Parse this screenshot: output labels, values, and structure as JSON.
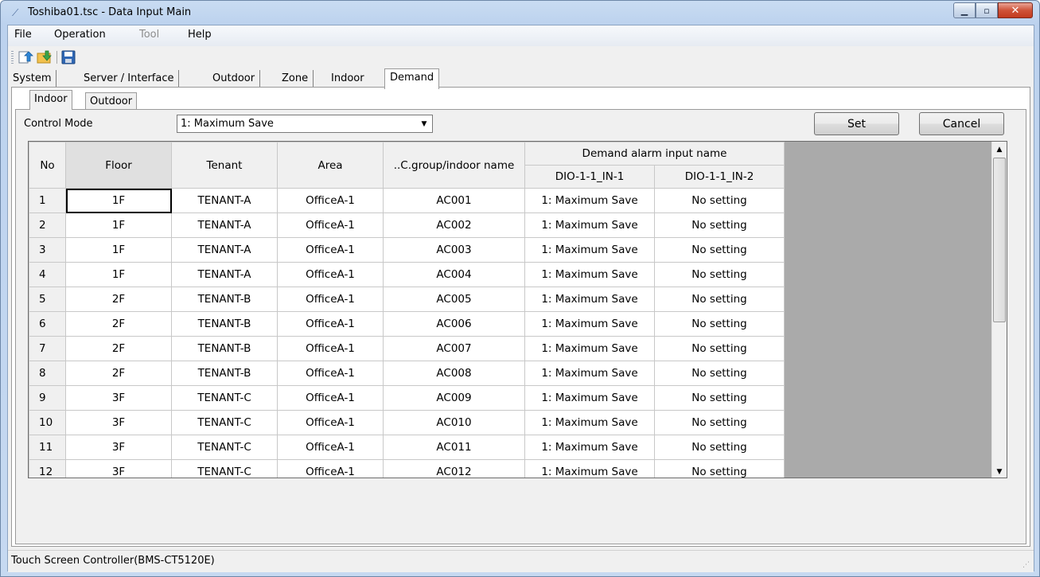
{
  "window": {
    "title": "Toshiba01.tsc - Data Input Main"
  },
  "menu": {
    "file": "File",
    "operation": "Operation",
    "tool": "Tool",
    "help": "Help"
  },
  "tabs": [
    "System",
    "Server / Interface",
    "Outdoor",
    "Zone",
    "Indoor",
    "Demand"
  ],
  "active_tab": "Demand",
  "subtabs": [
    "Indoor",
    "Outdoor"
  ],
  "active_subtab": "Indoor",
  "control_mode": {
    "label": "Control Mode",
    "value": "1: Maximum Save"
  },
  "buttons": {
    "set": "Set",
    "cancel": "Cancel"
  },
  "grid": {
    "headers": {
      "no": "No",
      "floor": "Floor",
      "tenant": "Tenant",
      "area": "Area",
      "group": "..C.group/indoor name",
      "demand_group": "Demand alarm input name",
      "in1": "DIO-1-1_IN-1",
      "in2": "DIO-1-1_IN-2"
    },
    "rows": [
      {
        "no": "1",
        "floor": "1F",
        "tenant": "TENANT-A",
        "area": "OfficeA-1",
        "group": "AC001",
        "in1": "1: Maximum Save",
        "in2": "No setting"
      },
      {
        "no": "2",
        "floor": "1F",
        "tenant": "TENANT-A",
        "area": "OfficeA-1",
        "group": "AC002",
        "in1": "1: Maximum Save",
        "in2": "No setting"
      },
      {
        "no": "3",
        "floor": "1F",
        "tenant": "TENANT-A",
        "area": "OfficeA-1",
        "group": "AC003",
        "in1": "1: Maximum Save",
        "in2": "No setting"
      },
      {
        "no": "4",
        "floor": "1F",
        "tenant": "TENANT-A",
        "area": "OfficeA-1",
        "group": "AC004",
        "in1": "1: Maximum Save",
        "in2": "No setting"
      },
      {
        "no": "5",
        "floor": "2F",
        "tenant": "TENANT-B",
        "area": "OfficeA-1",
        "group": "AC005",
        "in1": "1: Maximum Save",
        "in2": "No setting"
      },
      {
        "no": "6",
        "floor": "2F",
        "tenant": "TENANT-B",
        "area": "OfficeA-1",
        "group": "AC006",
        "in1": "1: Maximum Save",
        "in2": "No setting"
      },
      {
        "no": "7",
        "floor": "2F",
        "tenant": "TENANT-B",
        "area": "OfficeA-1",
        "group": "AC007",
        "in1": "1: Maximum Save",
        "in2": "No setting"
      },
      {
        "no": "8",
        "floor": "2F",
        "tenant": "TENANT-B",
        "area": "OfficeA-1",
        "group": "AC008",
        "in1": "1: Maximum Save",
        "in2": "No setting"
      },
      {
        "no": "9",
        "floor": "3F",
        "tenant": "TENANT-C",
        "area": "OfficeA-1",
        "group": "AC009",
        "in1": "1: Maximum Save",
        "in2": "No setting"
      },
      {
        "no": "10",
        "floor": "3F",
        "tenant": "TENANT-C",
        "area": "OfficeA-1",
        "group": "AC010",
        "in1": "1: Maximum Save",
        "in2": "No setting"
      },
      {
        "no": "11",
        "floor": "3F",
        "tenant": "TENANT-C",
        "area": "OfficeA-1",
        "group": "AC011",
        "in1": "1: Maximum Save",
        "in2": "No setting"
      },
      {
        "no": "12",
        "floor": "3F",
        "tenant": "TENANT-C",
        "area": "OfficeA-1",
        "group": "AC012",
        "in1": "1: Maximum Save",
        "in2": "No setting"
      }
    ]
  },
  "status": {
    "text": "Touch Screen Controller(BMS-CT5120E)"
  },
  "icons": {
    "app": "app-icon",
    "toolbar": [
      "upload-icon",
      "download-icon",
      "save-icon"
    ]
  }
}
